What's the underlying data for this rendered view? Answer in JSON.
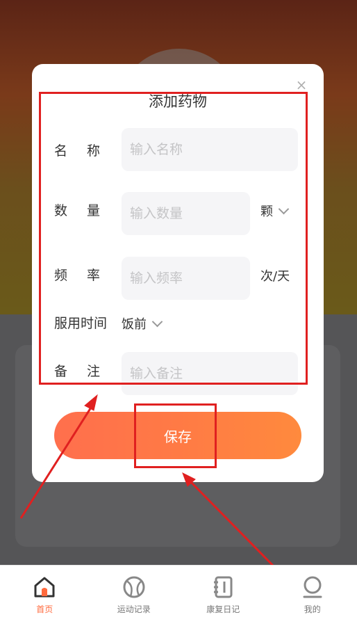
{
  "modal": {
    "title": "添加药物",
    "close_glyph": "×",
    "name_label": [
      "名",
      "称"
    ],
    "name_placeholder": "输入名称",
    "qty_label": [
      "数",
      "量"
    ],
    "qty_placeholder": "输入数量",
    "qty_unit": "颗",
    "freq_label": [
      "频",
      "率"
    ],
    "freq_placeholder": "输入频率",
    "freq_unit": "次/天",
    "time_label": "服用时间",
    "time_value": "饭前",
    "note_label": [
      "备",
      "注"
    ],
    "note_placeholder": "输入备注",
    "save_label": "保存"
  },
  "tabbar": {
    "items": [
      {
        "label": "首页",
        "icon": "home-icon",
        "active": true
      },
      {
        "label": "运动记录",
        "icon": "ball-icon",
        "active": false
      },
      {
        "label": "康复日记",
        "icon": "notebook-icon",
        "active": false
      },
      {
        "label": "我的",
        "icon": "user-icon",
        "active": false
      }
    ]
  },
  "colors": {
    "accent": "#ff6f4d",
    "annotation": "#e02020"
  }
}
